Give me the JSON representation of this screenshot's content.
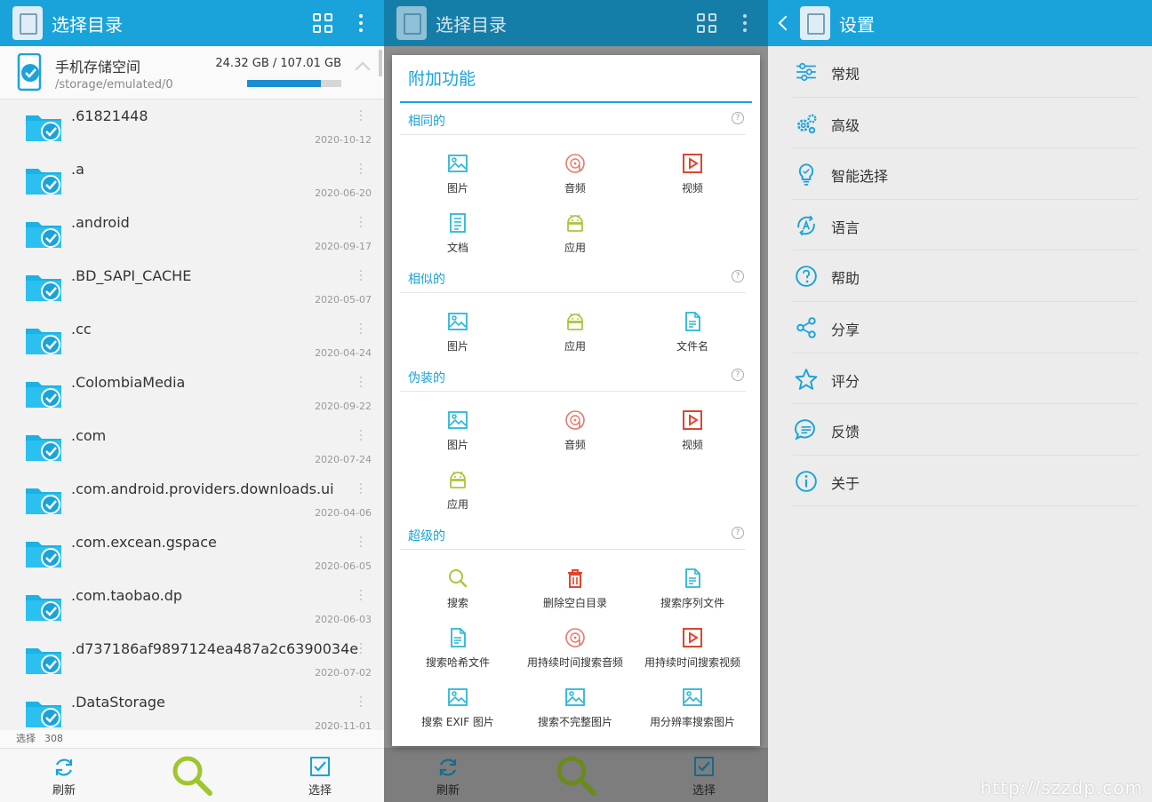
{
  "left_panel": {
    "title": "选择目录",
    "storage": {
      "name": "手机存储空间",
      "path": "/storage/emulated/0",
      "size": "24.32 GB / 107.01 GB",
      "usage_fraction": 0.78
    },
    "files": [
      {
        "name": ".61821448",
        "date": "2020-10-12"
      },
      {
        "name": ".a",
        "date": "2020-06-20"
      },
      {
        "name": ".android",
        "date": "2020-09-17"
      },
      {
        "name": ".BD_SAPI_CACHE",
        "date": "2020-05-07"
      },
      {
        "name": ".cc",
        "date": "2020-04-24"
      },
      {
        "name": ".ColombiaMedia",
        "date": "2020-09-22"
      },
      {
        "name": ".com",
        "date": "2020-07-24"
      },
      {
        "name": ".com.android.providers.downloads.ui",
        "date": "2020-04-06"
      },
      {
        "name": ".com.excean.gspace",
        "date": "2020-06-05"
      },
      {
        "name": ".com.taobao.dp",
        "date": "2020-06-03"
      },
      {
        "name": ".d737186af9897124ea487a2c6390034e",
        "date": "2020-07-02"
      },
      {
        "name": ".DataStorage",
        "date": "2020-11-01"
      }
    ],
    "status": {
      "label": "选择",
      "count": "308"
    },
    "bottom": {
      "refresh": "刷新",
      "select": "选择"
    }
  },
  "middle_panel": {
    "title": "选择目录",
    "bottom": {
      "refresh": "刷新",
      "select": "选择"
    },
    "dialog": {
      "title": "附加功能",
      "sections": [
        {
          "title": "相同的",
          "q": "?",
          "items": [
            {
              "label": "图片",
              "icon": "image-icon"
            },
            {
              "label": "音频",
              "icon": "audio-icon"
            },
            {
              "label": "视频",
              "icon": "video-icon"
            },
            {
              "label": "文档",
              "icon": "document-icon"
            },
            {
              "label": "应用",
              "icon": "android-icon"
            }
          ]
        },
        {
          "title": "相似的",
          "q": "?",
          "items": [
            {
              "label": "图片",
              "icon": "image-icon"
            },
            {
              "label": "应用",
              "icon": "android-icon"
            },
            {
              "label": "文件名",
              "icon": "filename-icon"
            }
          ]
        },
        {
          "title": "伪装的",
          "q": "?",
          "items": [
            {
              "label": "图片",
              "icon": "image-icon"
            },
            {
              "label": "音频",
              "icon": "audio-icon"
            },
            {
              "label": "视频",
              "icon": "video-icon"
            },
            {
              "label": "应用",
              "icon": "android-icon"
            }
          ]
        },
        {
          "title": "超级的",
          "q": "?",
          "items": [
            {
              "label": "搜索",
              "icon": "search-icon"
            },
            {
              "label": "删除空白目录",
              "icon": "trash-icon"
            },
            {
              "label": "搜索序列文件",
              "icon": "filename-icon"
            },
            {
              "label": "搜索哈希文件",
              "icon": "filename-icon"
            },
            {
              "label": "用持续时间搜索音频",
              "icon": "audio-icon"
            },
            {
              "label": "用持续时间搜索视频",
              "icon": "video-icon"
            },
            {
              "label": "搜索 EXIF 图片",
              "icon": "image-icon"
            },
            {
              "label": "搜索不完整图片",
              "icon": "image-icon"
            },
            {
              "label": "用分辨率搜索图片",
              "icon": "image-icon"
            }
          ]
        }
      ]
    }
  },
  "right_panel": {
    "title": "设置",
    "items": [
      {
        "label": "常规",
        "icon": "sliders-icon"
      },
      {
        "label": "高级",
        "icon": "gears-icon"
      },
      {
        "label": "智能选择",
        "icon": "bulb-icon"
      },
      {
        "label": "语言",
        "icon": "language-icon"
      },
      {
        "label": "帮助",
        "icon": "help-icon"
      },
      {
        "label": "分享",
        "icon": "share-icon"
      },
      {
        "label": "评分",
        "icon": "star-icon"
      },
      {
        "label": "反馈",
        "icon": "feedback-icon"
      },
      {
        "label": "关于",
        "icon": "info-icon"
      }
    ]
  },
  "watermark": "http://szzdp.com",
  "colors": {
    "accent": "#1aa3da",
    "audio": "#e8786a",
    "video": "#e0452f",
    "android": "#a6c83a",
    "image": "#29b6d8"
  }
}
